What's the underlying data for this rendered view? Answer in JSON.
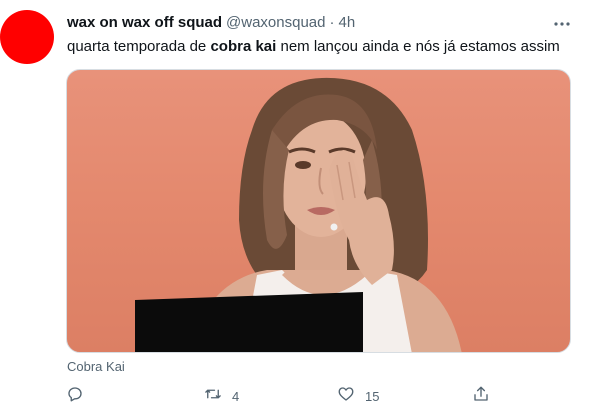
{
  "tweet": {
    "author_name": "wax on wax off squad",
    "handle": "@waxonsquad",
    "separator": "·",
    "time": "4h",
    "text_before": "quarta temporada de ",
    "text_bold": "cobra kai",
    "text_after": " nem lançou ainda e nós já estamos assim",
    "avatar_color": "#ff0000",
    "media_caption": "Cobra Kai"
  },
  "actions": {
    "reply_count": "",
    "retweet_count": "4",
    "like_count": "15"
  },
  "icons": {
    "more": "more-icon",
    "reply": "reply-icon",
    "retweet": "retweet-icon",
    "like": "heart-icon",
    "share": "share-icon"
  }
}
